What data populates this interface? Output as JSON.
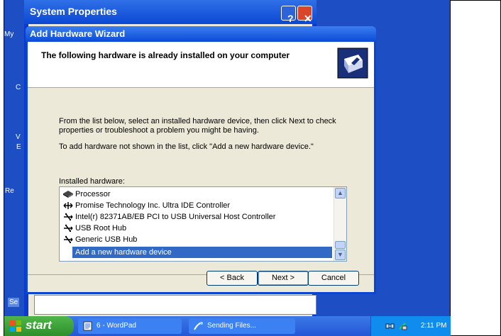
{
  "desktop": {
    "labels": [
      "My",
      "C",
      "V",
      "E",
      "Re",
      "Se"
    ]
  },
  "sysprop": {
    "title": "System Properties",
    "help_glyph": "?",
    "close_glyph": "✕"
  },
  "wizard": {
    "title": "Add Hardware Wizard",
    "heading": "The following hardware is already installed on your computer",
    "paragraph1": "From the list below, select an installed hardware device, then click Next to check properties or troubleshoot a problem you might be having.",
    "paragraph2": "To add hardware not shown in the list, click \"Add a new hardware device.\"",
    "installed_label": "Installed hardware:",
    "items": [
      {
        "label": "Processor",
        "icon": "processor-icon"
      },
      {
        "label": "Promise Technology Inc. Ultra IDE Controller",
        "icon": "ide-controller-icon"
      },
      {
        "label": "Intel(r) 82371AB/EB PCI to USB Universal Host Controller",
        "icon": "usb-icon"
      },
      {
        "label": "USB Root Hub",
        "icon": "usb-icon"
      },
      {
        "label": "Generic USB Hub",
        "icon": "usb-icon"
      },
      {
        "label": "Add a new hardware device",
        "icon": "",
        "selected": true
      }
    ],
    "buttons": {
      "back": "< Back",
      "next": "Next >",
      "cancel": "Cancel"
    }
  },
  "taskbar": {
    "start": "start",
    "tasks": [
      {
        "label": "6 - WordPad",
        "icon": "wordpad-icon"
      },
      {
        "label": "Sending Files...",
        "icon": "sending-files-icon"
      }
    ],
    "clock": "2:11 PM"
  },
  "colors": {
    "desktop": "#1e4ec4",
    "titlebar": "#0b4ad8",
    "dialog": "#ece9d8",
    "selection": "#316ac5",
    "start_button": "#3aa137"
  }
}
